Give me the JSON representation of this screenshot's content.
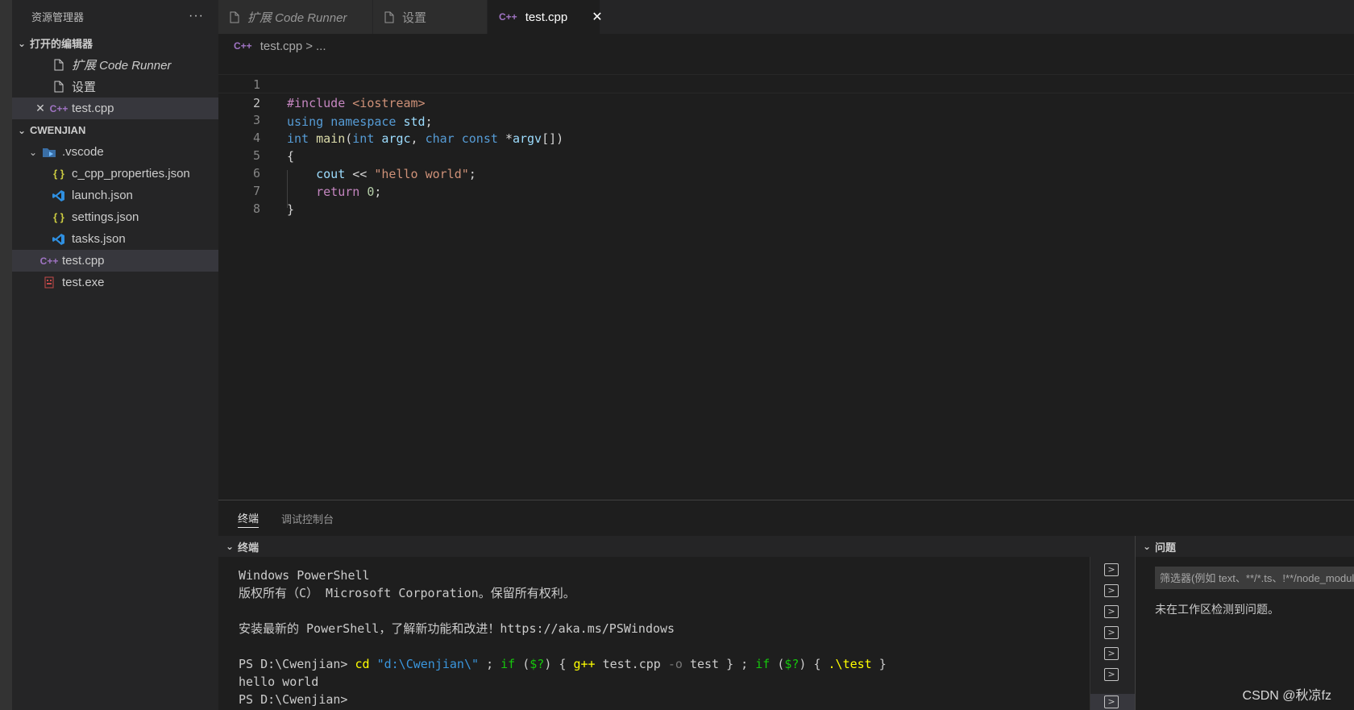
{
  "sidebar": {
    "title": "资源管理器",
    "more": "···",
    "open_editors": {
      "label": "打开的编辑器",
      "items": [
        {
          "name_prefix": "扩展",
          "name": " Code Runner",
          "icon": "file-icon"
        },
        {
          "name": "设置",
          "icon": "file-icon"
        },
        {
          "name": "test.cpp",
          "icon": "cpp-icon",
          "close": "✕"
        }
      ]
    },
    "folder": {
      "label": "CWENJIAN",
      "subfolder": ".vscode",
      "files": [
        "c_cpp_properties.json",
        "launch.json",
        "settings.json",
        "tasks.json"
      ],
      "root_files": [
        "test.cpp",
        "test.exe"
      ]
    }
  },
  "tabs": [
    {
      "prefix": "扩展",
      "label": " Code Runner"
    },
    {
      "label": "设置"
    },
    {
      "label": "test.cpp",
      "close": "✕"
    }
  ],
  "breadcrumb": {
    "file": "test.cpp",
    "sep": ">",
    "rest": "..."
  },
  "editor": {
    "line_numbers": [
      "1",
      "2",
      "3",
      "4",
      "5",
      "6",
      "7",
      "8"
    ],
    "current_line": 2
  },
  "panel": {
    "tabs": [
      "终端",
      "调试控制台"
    ],
    "terminal_header": "终端",
    "problems_header": "问题",
    "filter_placeholder": "筛选器(例如 text、**/*.ts、!**/node_modules/**)",
    "no_problems": "未在工作区检测到问题。",
    "terminal": {
      "line1": "Windows PowerShell",
      "line2": "版权所有（C） Microsoft Corporation。保留所有权利。",
      "line3": "安装最新的 PowerShell，了解新功能和改进！https://aka.ms/PSWindows",
      "prompt": "PS D:\\Cwenjian>",
      "output": "hello world",
      "prompt2": "PS D:\\Cwenjian>"
    }
  },
  "watermark": "CSDN @秋凉fz",
  "colors": {
    "accent": "#007acc",
    "background": "#1e1e1e",
    "sidebar": "#252526"
  }
}
